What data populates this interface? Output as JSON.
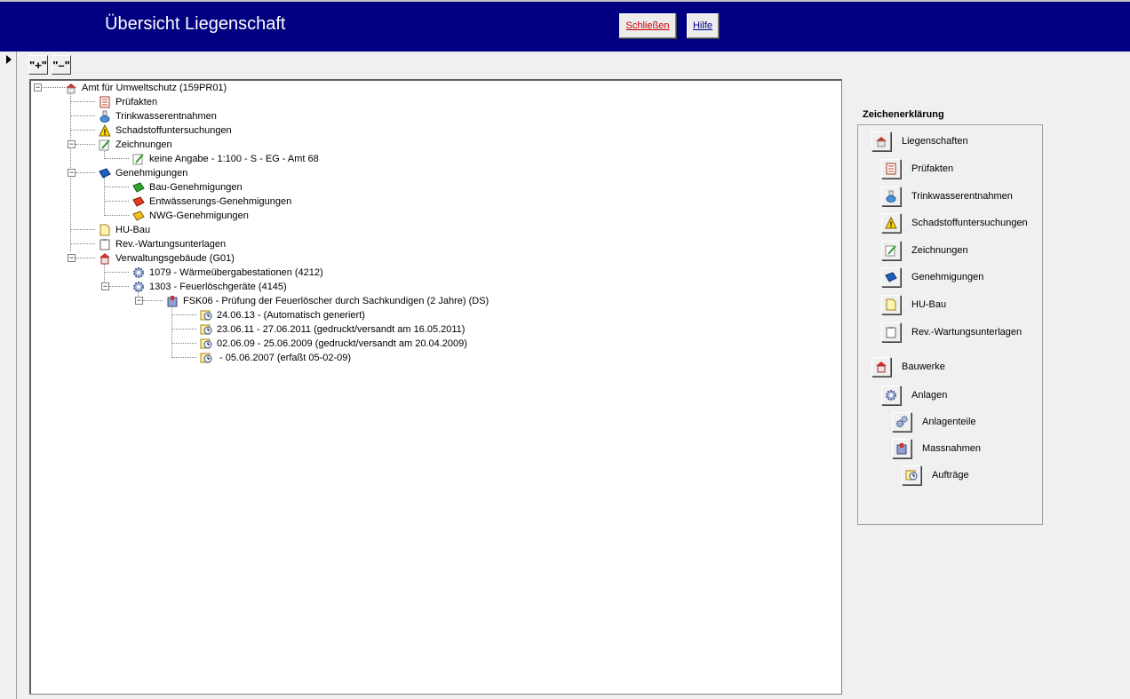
{
  "header": {
    "title": "Übersicht Liegenschaft",
    "close_label": "Schließen",
    "help_label": "Hilfe",
    "bg_color": "#000080"
  },
  "toolbar": {
    "expand_label": "\"+\"",
    "collapse_label": "\"–\""
  },
  "tree": {
    "root": "Amt für Umweltschutz (159PR01)",
    "pruefakten": "Prüfakten",
    "trinkwasser": "Trinkwasserentnahmen",
    "schadstoff": "Schadstoffuntersuchungen",
    "zeichnungen": "Zeichnungen",
    "zeichnung_1": "keine Angabe - 1:100 - S - EG - Amt 68",
    "genehmigungen": "Genehmigungen",
    "bau_gen": "Bau-Genehmigungen",
    "entw_gen": "Entwässerungs-Genehmigungen",
    "nwg_gen": "NWG-Genehmigungen",
    "hubau": "HU-Bau",
    "rev": "Rev.-Wartungsunterlagen",
    "verwaltung": "Verwaltungsgebäude (G01)",
    "anlage_1079": "1079 - Wärmeübergabestationen (4212)",
    "anlage_1303": "1303 - Feuerlöschgeräte (4145)",
    "massnahme_fsk06": "FSK06 - Prüfung der Feuerlöscher durch Sachkundigen (2 Jahre) (DS)",
    "auftrag_1": "24.06.13 -  (Automatisch generiert)",
    "auftrag_2": "23.06.11 - 27.06.2011 (gedruckt/versandt am 16.05.2011)",
    "auftrag_3": "02.06.09 - 25.06.2009 (gedruckt/versandt am 20.04.2009)",
    "auftrag_4": " - 05.06.2007 (erfaßt 05-02-09)"
  },
  "legend": {
    "title": "Zeichenerklärung",
    "items": [
      {
        "label": "Liegenschaften",
        "icon": "property-icon"
      },
      {
        "label": "Prüfakten",
        "icon": "document-icon"
      },
      {
        "label": "Trinkwasserentnahmen",
        "icon": "flask-icon"
      },
      {
        "label": "Schadstoffuntersuchungen",
        "icon": "warning-icon"
      },
      {
        "label": "Zeichnungen",
        "icon": "drawing-icon"
      },
      {
        "label": "Genehmigungen",
        "icon": "book-icon"
      },
      {
        "label": "HU-Bau",
        "icon": "page-icon"
      },
      {
        "label": "Rev.-Wartungsunterlagen",
        "icon": "clipboard-icon"
      },
      {
        "label": "Bauwerke",
        "icon": "building-icon"
      },
      {
        "label": "Anlagen",
        "icon": "gear-icon"
      },
      {
        "label": "Anlagenteile",
        "icon": "gears-icon"
      },
      {
        "label": "Massnahmen",
        "icon": "measure-icon"
      },
      {
        "label": "Aufträge",
        "icon": "order-clock-icon"
      }
    ]
  }
}
